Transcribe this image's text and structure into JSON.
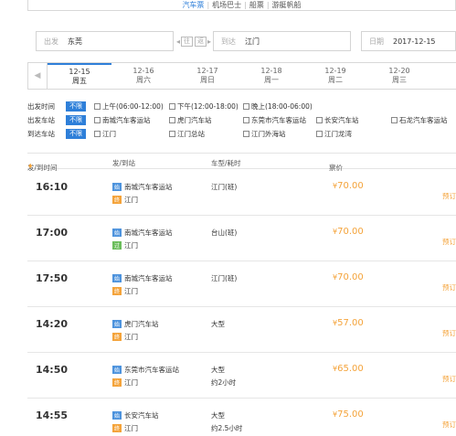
{
  "topnav": [
    "汽车票",
    "机场巴士",
    "船票",
    "游艇帆船"
  ],
  "search": {
    "from_label": "出发",
    "from_value": "东莞",
    "swap": [
      "往",
      "返"
    ],
    "to_label": "到达",
    "to_value": "江门",
    "date_label": "日期",
    "date_value": "2017-12-15"
  },
  "datebar": {
    "prev": "◀",
    "days": [
      {
        "d": "12-15",
        "w": "周五"
      },
      {
        "d": "12-16",
        "w": "周六"
      },
      {
        "d": "12-17",
        "w": "周日"
      },
      {
        "d": "12-18",
        "w": "周一"
      },
      {
        "d": "12-19",
        "w": "周二"
      },
      {
        "d": "12-20",
        "w": "周三"
      }
    ]
  },
  "filters": {
    "any": "不限",
    "time_label": "出发时间",
    "times": [
      "上午(06:00-12:00)",
      "下午(12:00-18:00)",
      "晚上(18:00-06:00)"
    ],
    "from_label": "出发车站",
    "from_stations": [
      "南城汽车客运站",
      "虎门汽车站",
      "东莞市汽车客运站",
      "长安汽车站",
      "石龙汽车客运站"
    ],
    "to_label": "到达车站",
    "to_stations": [
      "江门",
      "江门总站",
      "江门外海站",
      "江门龙湾"
    ]
  },
  "table": {
    "headers": {
      "time": "发/到时间",
      "stations": "发/到站",
      "type": "车型/耗时",
      "price": "票价"
    },
    "book_label": "预订",
    "rows": [
      {
        "time": "16:10",
        "from_tag": "始",
        "from": "南城汽车客运站",
        "to_tag": "终",
        "to": "江门",
        "type": "江门(班)",
        "duration": "",
        "price": "70.00"
      },
      {
        "time": "17:00",
        "from_tag": "始",
        "from": "南城汽车客运站",
        "to_tag": "过",
        "to": "江门",
        "type": "台山(班)",
        "duration": "",
        "price": "70.00"
      },
      {
        "time": "17:50",
        "from_tag": "始",
        "from": "南城汽车客运站",
        "to_tag": "终",
        "to": "江门",
        "type": "江门(班)",
        "duration": "",
        "price": "70.00"
      },
      {
        "time": "14:20",
        "from_tag": "始",
        "from": "虎门汽车站",
        "to_tag": "终",
        "to": "江门",
        "type": "大型",
        "duration": "",
        "price": "57.00"
      },
      {
        "time": "14:50",
        "from_tag": "始",
        "from": "东莞市汽车客运站",
        "to_tag": "终",
        "to": "江门",
        "type": "大型",
        "duration": "约2小时",
        "price": "65.00"
      },
      {
        "time": "14:55",
        "from_tag": "始",
        "from": "长安汽车站",
        "to_tag": "终",
        "to": "江门",
        "type": "大型",
        "duration": "约2.5小时",
        "price": "75.00"
      }
    ]
  },
  "colors": {
    "accent": "#2e7fd9",
    "price": "#f4a33a"
  }
}
